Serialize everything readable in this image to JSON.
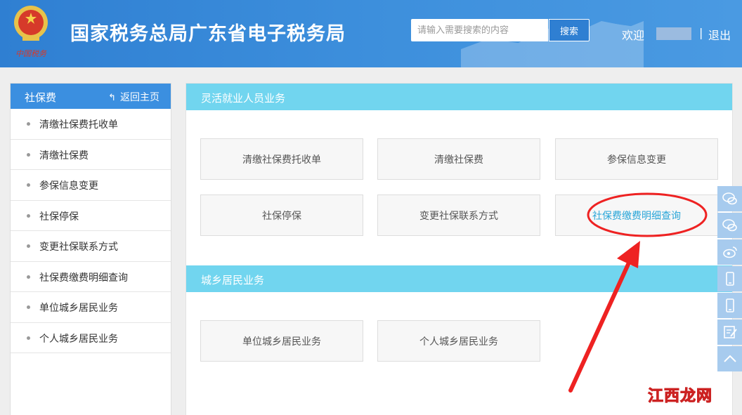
{
  "header": {
    "site_title": "国家税务总局广东省电子税务局",
    "search_placeholder": "请输入需要搜索的内容",
    "search_button": "搜索",
    "welcome": "欢迎",
    "divider": "|",
    "logout": "退出",
    "emblem_text": "中国税务"
  },
  "sidebar": {
    "title": "社保费",
    "back_label": "返回主页",
    "items": [
      {
        "label": "清缴社保费托收单"
      },
      {
        "label": "清缴社保费"
      },
      {
        "label": "参保信息变更"
      },
      {
        "label": "社保停保"
      },
      {
        "label": "变更社保联系方式"
      },
      {
        "label": "社保费缴费明细查询"
      },
      {
        "label": "单位城乡居民业务"
      },
      {
        "label": "个人城乡居民业务"
      }
    ]
  },
  "main": {
    "sections": [
      {
        "title": "灵活就业人员业务",
        "tiles": [
          {
            "label": "清缴社保费托收单"
          },
          {
            "label": "清缴社保费"
          },
          {
            "label": "参保信息变更"
          },
          {
            "label": "社保停保"
          },
          {
            "label": "变更社保联系方式"
          },
          {
            "label": "社保费缴费明细查询"
          }
        ]
      },
      {
        "title": "城乡居民业务",
        "tiles": [
          {
            "label": "单位城乡居民业务"
          },
          {
            "label": "个人城乡居民业务"
          }
        ]
      }
    ]
  },
  "float_toolbar": [
    "wechat-icon",
    "wechat-icon",
    "weibo-icon",
    "mobile-icon",
    "mobile-icon",
    "edit-icon",
    "back-to-top-icon"
  ],
  "watermark": "江西龙网",
  "colors": {
    "header_blue": "#2f7fd2",
    "sidebar_head": "#3b8fe0",
    "section_head": "#71d5ef",
    "highlight_text": "#2aa6d8",
    "annotation_red": "#ee2222"
  }
}
